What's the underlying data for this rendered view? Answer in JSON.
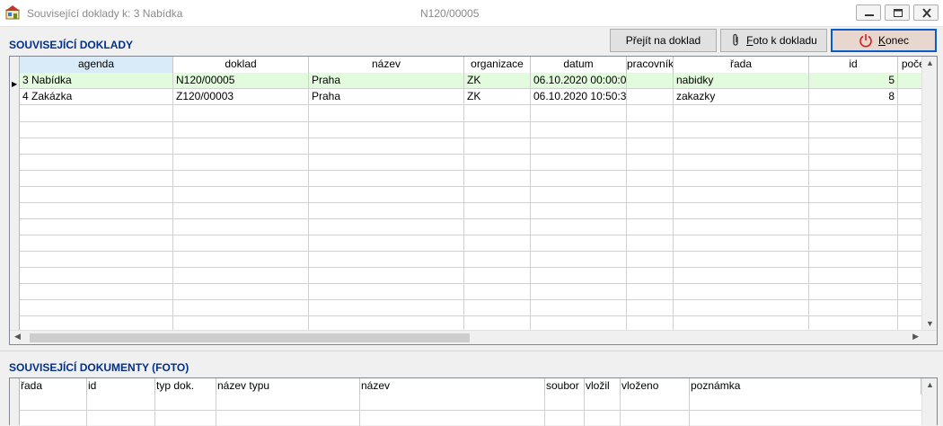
{
  "window": {
    "title": "Související doklady k: 3 Nabídka",
    "document": "N120/00005"
  },
  "toolbar": {
    "goto_label": "Přejít na doklad",
    "foto_label_u": "F",
    "foto_label_rest": "oto k dokladu",
    "konec_label_u": "K",
    "konec_label_rest": "onec"
  },
  "top_section": {
    "heading": "SOUVISEJÍCÍ DOKLADY",
    "columns": [
      "agenda",
      "doklad",
      "název",
      "organizace",
      "datum",
      "pracovník",
      "řada",
      "id",
      "počet"
    ],
    "rows": [
      [
        "3 Nabídka",
        "N120/00005",
        "Praha",
        "ZK",
        "06.10.2020 00:00:0",
        "",
        "nabidky",
        "5",
        ""
      ],
      [
        "4 Zakázka",
        "Z120/00003",
        "Praha",
        "ZK",
        "06.10.2020 10:50:3",
        "",
        "zakazky",
        "8",
        ""
      ]
    ]
  },
  "bottom_section": {
    "heading": "SOUVISEJÍCÍ DOKUMENTY (FOTO)",
    "columns": [
      "řada",
      "id",
      "typ dok.",
      "název typu",
      "název",
      "soubor",
      "vložil",
      "vloženo",
      "poznámka"
    ]
  },
  "colors": {
    "heading": "#003087",
    "selected_row": "#e2fbdc",
    "header_active": "#d9ebf9",
    "konec_bg": "#e8d7ce",
    "konec_border": "#0a5cc9"
  },
  "icons": {
    "app": "app-icon",
    "minimize": "minimize-icon",
    "maximize": "maximize-icon",
    "close": "close-icon",
    "foto": "paperclip-icon",
    "konec": "power-icon"
  }
}
